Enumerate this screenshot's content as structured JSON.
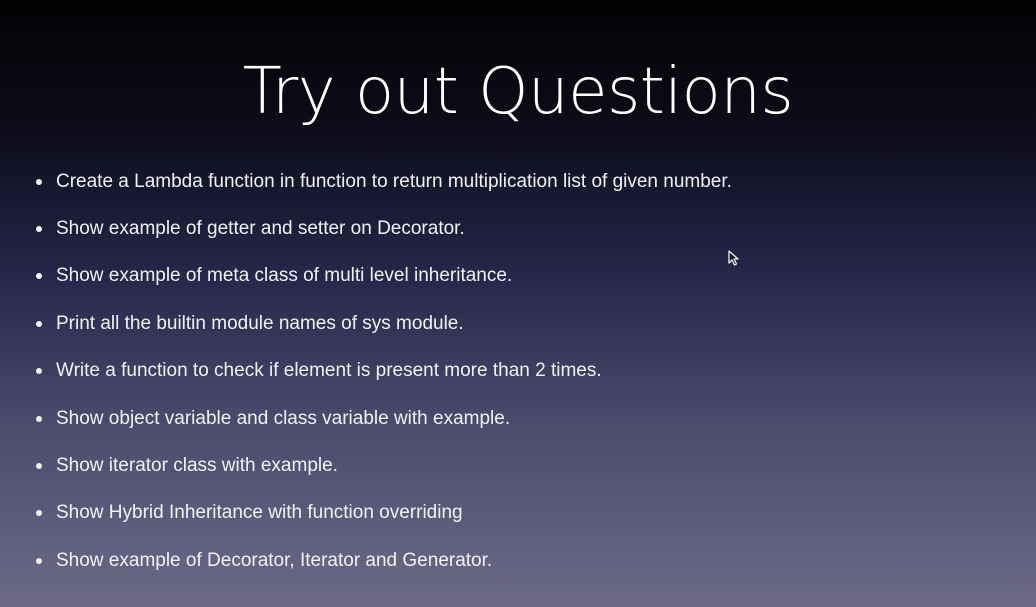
{
  "slide": {
    "title": "Try out Questions",
    "bullets": [
      "Create a Lambda function in function to return multiplication list of given number.",
      "Show example of getter and setter on Decorator.",
      "Show example of meta class of multi level inheritance.",
      "Print all the builtin module names of sys module.",
      "Write a function to check if element is present more than 2 times.",
      "Show object variable and class variable with example.",
      "Show iterator class with example.",
      "Show Hybrid Inheritance with function overriding",
      "Show example of Decorator, Iterator and Generator."
    ]
  },
  "icons": {
    "cursor": "mouse-pointer-icon"
  },
  "colors": {
    "text": "#ffffff",
    "background_top": "#020204",
    "background_bottom": "#6c6a86"
  }
}
